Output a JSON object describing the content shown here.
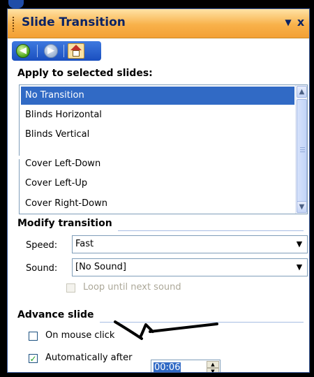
{
  "pane": {
    "title": "Slide Transition",
    "dropdown_glyph": "▼",
    "close_glyph": "x"
  },
  "nav": {
    "back_icon": "back-arrow-icon",
    "forward_icon": "forward-arrow-icon",
    "home_icon": "home-icon"
  },
  "apply": {
    "label": "Apply to selected slides:",
    "items": [
      {
        "label": "No Transition",
        "selected": true
      },
      {
        "label": "Blinds Horizontal",
        "selected": false
      },
      {
        "label": "Blinds Vertical",
        "selected": false
      },
      {
        "label": "Cover Left-Down",
        "selected": false
      },
      {
        "label": "Cover Left-Up",
        "selected": false
      },
      {
        "label": "Cover Right-Down",
        "selected": false
      }
    ]
  },
  "modify": {
    "label": "Modify transition",
    "speed_label": "Speed:",
    "speed_value": "Fast",
    "sound_label": "Sound:",
    "sound_value": "[No Sound]",
    "loop_label": "Loop until next sound",
    "loop_checked": false,
    "loop_enabled": false
  },
  "advance": {
    "label": "Advance slide",
    "mouse_click_label": "On mouse click",
    "mouse_click_checked": false,
    "auto_label": "Automatically after",
    "auto_checked": true,
    "auto_value": "00:06"
  },
  "colors": {
    "title_bar": "#f8b14a",
    "selection": "#316ac5",
    "section_text": "#000000"
  }
}
